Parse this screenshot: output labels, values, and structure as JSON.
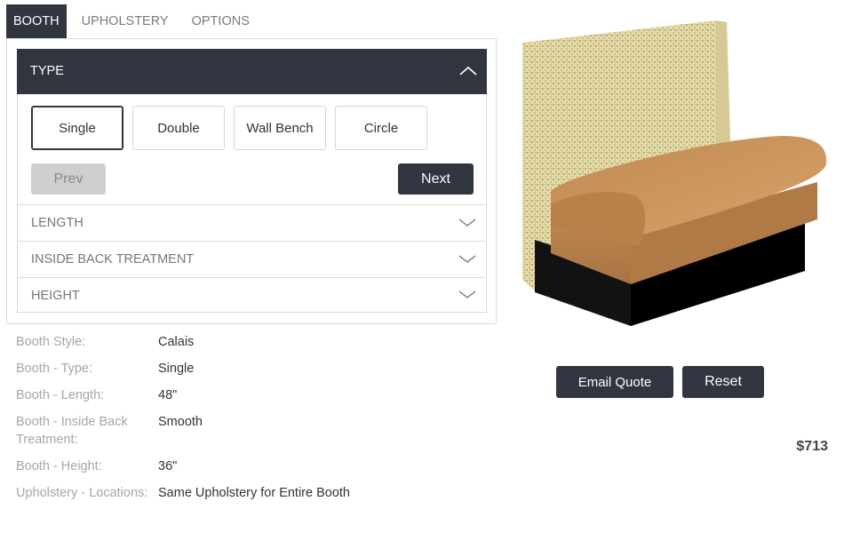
{
  "tabs": [
    {
      "label": "BOOTH",
      "active": true
    },
    {
      "label": "UPHOLSTERY",
      "active": false
    },
    {
      "label": "OPTIONS",
      "active": false
    }
  ],
  "accordion": {
    "type": {
      "title": "TYPE",
      "options": [
        "Single",
        "Double",
        "Wall Bench",
        "Circle"
      ],
      "selected": "Single",
      "prev_label": "Prev",
      "next_label": "Next"
    },
    "collapsed": [
      "LENGTH",
      "INSIDE BACK TREATMENT",
      "HEIGHT"
    ]
  },
  "summary": [
    {
      "key": "Booth Style:",
      "value": "Calais"
    },
    {
      "key": "Booth - Type:",
      "value": "Single"
    },
    {
      "key": "Booth - Length:",
      "value": "48\""
    },
    {
      "key": "Booth - Inside Back Treatment:",
      "value": "Smooth"
    },
    {
      "key": "Booth - Height:",
      "value": "36\""
    },
    {
      "key": "Upholstery - Locations:",
      "value": "Same Upholstery for Entire Booth"
    }
  ],
  "actions": {
    "email_label": "Email Quote",
    "reset_label": "Reset"
  },
  "price": "$713",
  "colors": {
    "dark": "#30353f",
    "back_fabric": "#e3d8a6",
    "seat_leather": "#c9925a",
    "base": "#111111"
  }
}
